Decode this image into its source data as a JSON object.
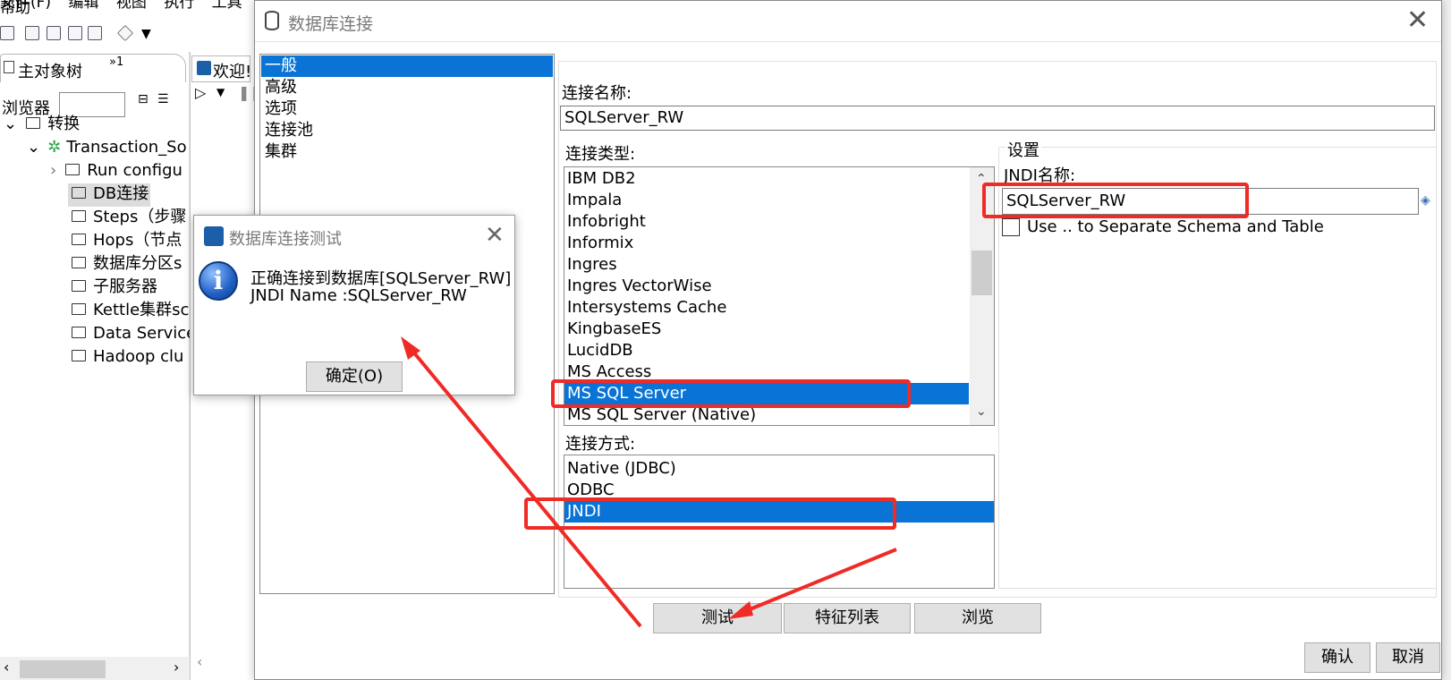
{
  "main_window": {
    "menu": [
      "文件(F)",
      "编辑",
      "视图",
      "执行",
      "工具",
      "帮助"
    ],
    "tab_main_title": "主对象树",
    "tab_more": "»1",
    "browser_label": "浏览器",
    "welcome_tab": "欢迎!",
    "tree": [
      {
        "label": "转换"
      },
      {
        "label": "Transaction_So"
      },
      {
        "label": "Run configu"
      },
      {
        "label": "DB连接"
      },
      {
        "label": "Steps（步骤"
      },
      {
        "label": "Hops（节点"
      },
      {
        "label": "数据库分区s"
      },
      {
        "label": "子服务器"
      },
      {
        "label": "Kettle集群sc"
      },
      {
        "label": "Data Service"
      },
      {
        "label": "Hadoop clu"
      }
    ]
  },
  "dialog": {
    "title": "数据库连接",
    "categories": [
      "一般",
      "高级",
      "选项",
      "连接池",
      "集群"
    ],
    "selected_category": "一般",
    "connection_name_label": "连接名称:",
    "connection_name_value": "SQLServer_RW",
    "connection_type_label": "连接类型:",
    "connection_types": [
      "IBM DB2",
      "Impala",
      "Infobright",
      "Informix",
      "Ingres",
      "Ingres VectorWise",
      "Intersystems Cache",
      "KingbaseES",
      "LucidDB",
      "MS Access",
      "MS SQL Server",
      "MS SQL Server (Native)"
    ],
    "selected_connection_type": "MS SQL Server",
    "access_label": "连接方式:",
    "access_methods": [
      "Native (JDBC)",
      "ODBC",
      "JNDI"
    ],
    "selected_access": "JNDI",
    "settings_label": "设置",
    "jndi_label": "JNDI名称:",
    "jndi_value": "SQLServer_RW",
    "checkbox_label": "Use .. to Separate Schema and Table",
    "buttons": {
      "test": "测试",
      "features": "特征列表",
      "explore": "浏览",
      "ok": "确认",
      "cancel": "取消"
    }
  },
  "test_dialog": {
    "title": "数据库连接测试",
    "message_line1": "正确连接到数据库[SQLServer_RW]",
    "message_line2": "JNDI Name :SQLServer_RW",
    "ok_button": "确定(O)"
  },
  "colors": {
    "selection": "#0a74d6",
    "annotation": "#f02a25"
  }
}
